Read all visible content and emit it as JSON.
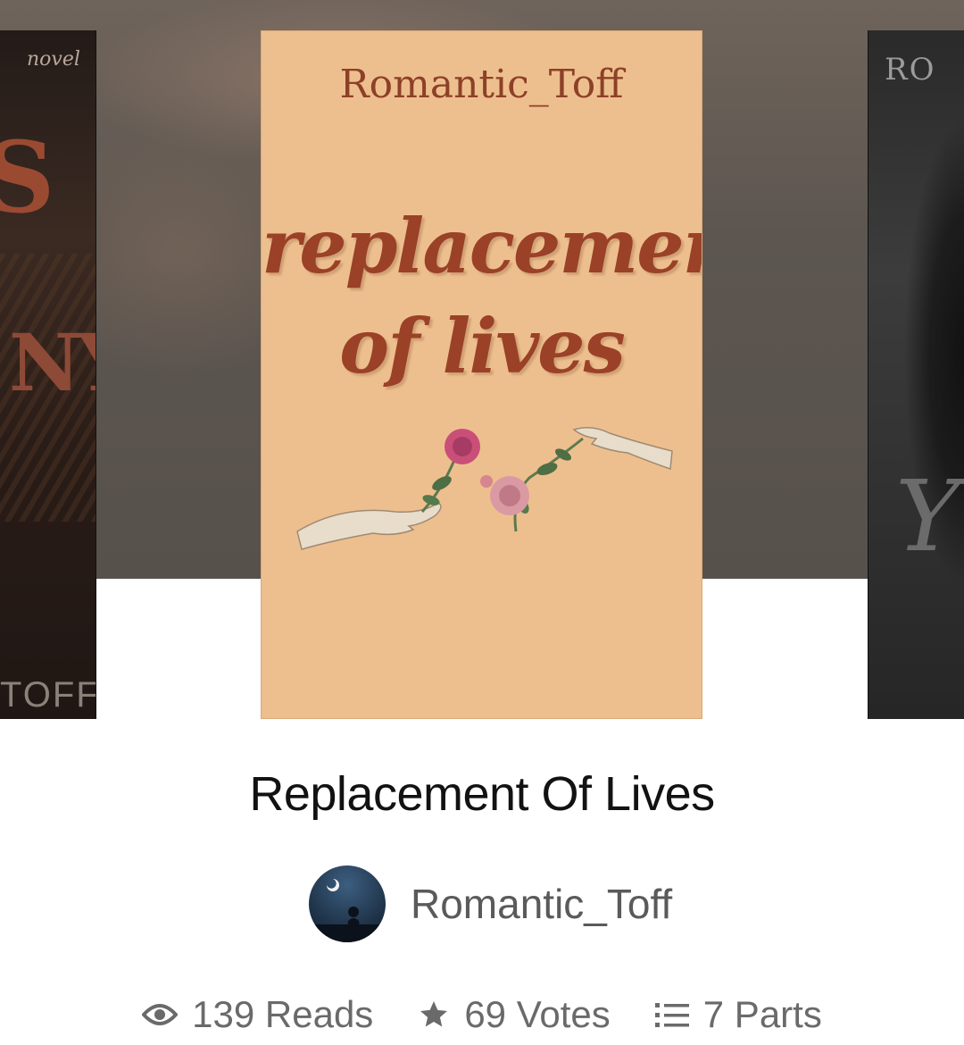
{
  "covers": {
    "left": {
      "text_top": "novel",
      "text_mid": "S",
      "text_low": "NY",
      "text_bottom": "TOFF"
    },
    "main": {
      "author": "Romantic_Toff",
      "title_line1": "replacement",
      "title_line2": "of lives"
    },
    "right": {
      "text_top": "RO",
      "text_mid": "Y"
    }
  },
  "story": {
    "title": "Replacement Of Lives",
    "author": "Romantic_Toff"
  },
  "stats": {
    "reads": "139 Reads",
    "votes": "69 Votes",
    "parts": "7 Parts"
  },
  "colors": {
    "cover_bg": "#eebf8e",
    "cover_text": "#9a4128",
    "stat_text": "#6a6a6a"
  },
  "icons": {
    "reads": "eye-icon",
    "votes": "star-icon",
    "parts": "list-icon"
  }
}
